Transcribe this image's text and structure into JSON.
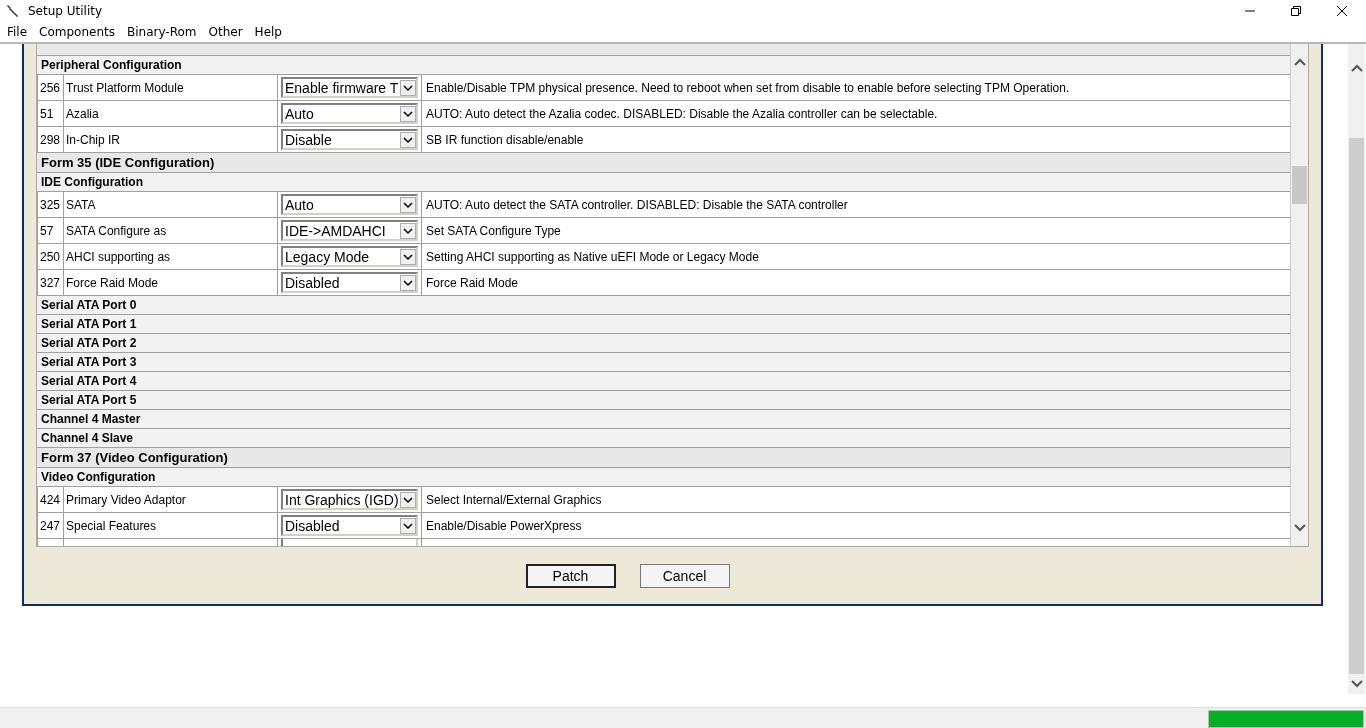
{
  "window": {
    "title": "Setup Utility"
  },
  "menu": [
    "File",
    "Components",
    "Binary-Rom",
    "Other",
    "Help"
  ],
  "rows": [
    {
      "kind": "section",
      "label": "Peripheral Configuration"
    },
    {
      "kind": "setting",
      "number": "256",
      "name": "Trust Platform Module",
      "value": "Enable firmware T",
      "description": "Enable/Disable TPM physical presence. Need to reboot when set from disable to enable before selecting TPM Operation."
    },
    {
      "kind": "setting",
      "number": "51",
      "name": "Azalia",
      "value": "Auto",
      "description": "AUTO: Auto detect the Azalia codec. DISABLED: Disable the Azalia controller can be selectable."
    },
    {
      "kind": "setting",
      "number": "298",
      "name": "In-Chip IR",
      "value": "Disable",
      "description": "SB IR function disable/enable"
    },
    {
      "kind": "form",
      "label": "Form 35 (IDE Configuration)"
    },
    {
      "kind": "section",
      "label": "IDE Configuration"
    },
    {
      "kind": "setting",
      "number": "325",
      "name": "SATA",
      "value": "Auto",
      "description": "AUTO: Auto detect the SATA controller. DISABLED: Disable the SATA controller"
    },
    {
      "kind": "setting",
      "number": "57",
      "name": "SATA Configure as",
      "value": "IDE->AMDAHCI",
      "description": "Set SATA Configure Type"
    },
    {
      "kind": "setting",
      "number": "250",
      "name": "AHCI supporting as",
      "value": "Legacy Mode",
      "description": "Setting AHCI supporting as Native uEFI Mode or Legacy Mode"
    },
    {
      "kind": "setting",
      "number": "327",
      "name": "Force Raid Mode",
      "value": "Disabled",
      "description": "Force Raid Mode"
    },
    {
      "kind": "section",
      "label": "Serial ATA Port 0"
    },
    {
      "kind": "section",
      "label": "Serial ATA Port 1"
    },
    {
      "kind": "section",
      "label": "Serial ATA Port 2"
    },
    {
      "kind": "section",
      "label": "Serial ATA Port 3"
    },
    {
      "kind": "section",
      "label": "Serial ATA Port 4"
    },
    {
      "kind": "section",
      "label": "Serial ATA Port 5"
    },
    {
      "kind": "section",
      "label": "Channel 4 Master"
    },
    {
      "kind": "section",
      "label": "Channel 4 Slave"
    },
    {
      "kind": "form",
      "label": "Form 37 (Video Configuration)"
    },
    {
      "kind": "section",
      "label": "Video Configuration"
    },
    {
      "kind": "setting",
      "number": "424",
      "name": "Primary Video Adaptor",
      "value": "Int Graphics (IGD)",
      "description": "Select Internal/External Graphics"
    },
    {
      "kind": "setting",
      "number": "247",
      "name": "Special Features",
      "value": "Disabled",
      "description": "Enable/Disable PowerXpress"
    }
  ],
  "buttons": [
    {
      "label": "Patch",
      "default": true
    },
    {
      "label": "Cancel",
      "default": false
    }
  ],
  "status_bar": {
    "progress": {
      "level": 1
    }
  }
}
